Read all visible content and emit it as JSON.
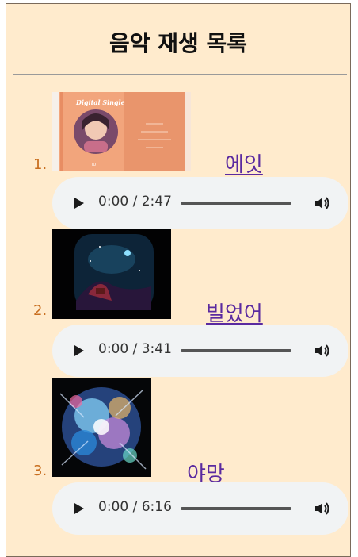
{
  "title": "음악 재생 목록",
  "songs": [
    {
      "number": "1.",
      "title": "에잇",
      "time": "0:00 / 2:47",
      "cover": {
        "badge": "Digital Single",
        "artist": "IU",
        "colors": {
          "bg": "#f0a07a",
          "panel": "#e9956c"
        }
      }
    },
    {
      "number": "2.",
      "title": "빌었어",
      "time": "0:00 / 3:41"
    },
    {
      "number": "3.",
      "title": "야망",
      "time": "0:00 / 6:16"
    }
  ],
  "colors": {
    "background": "#ffebcd",
    "number": "#c86e1f",
    "link": "#5a2aa0",
    "player": "#f1f3f4"
  }
}
